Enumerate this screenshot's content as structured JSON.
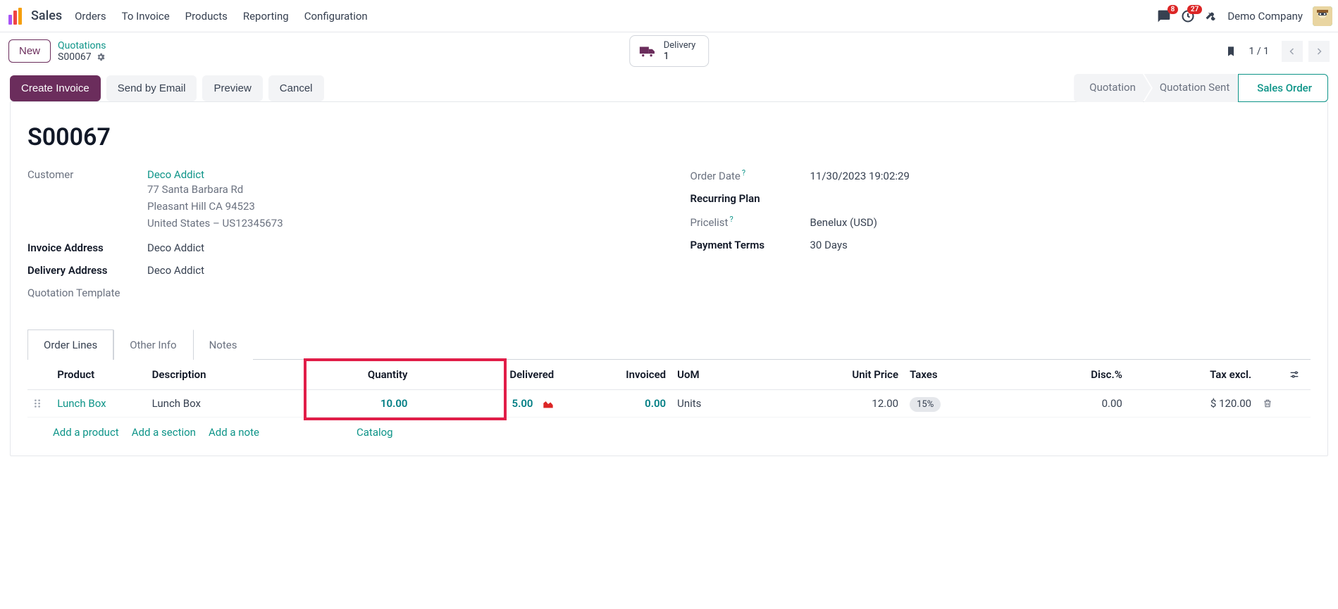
{
  "nav": {
    "app": "Sales",
    "links": [
      "Orders",
      "To Invoice",
      "Products",
      "Reporting",
      "Configuration"
    ],
    "messages_badge": "8",
    "activities_badge": "27",
    "company": "Demo Company"
  },
  "breadcrumb": {
    "new_label": "New",
    "parent": "Quotations",
    "current": "S00067"
  },
  "smart_button": {
    "label": "Delivery",
    "count": "1"
  },
  "pager": {
    "text": "1 / 1"
  },
  "actions": {
    "create_invoice": "Create Invoice",
    "send_email": "Send by Email",
    "preview": "Preview",
    "cancel": "Cancel"
  },
  "status": {
    "quotation": "Quotation",
    "quotation_sent": "Quotation Sent",
    "sales_order": "Sales Order"
  },
  "order": {
    "name": "S00067",
    "fields": {
      "customer_label": "Customer",
      "customer_link": "Deco Addict",
      "addr1": "77 Santa Barbara Rd",
      "addr2": "Pleasant Hill CA 94523",
      "addr3": "United States – US12345673",
      "invoice_address_label": "Invoice Address",
      "invoice_address": "Deco Addict",
      "delivery_address_label": "Delivery Address",
      "delivery_address": "Deco Addict",
      "quotation_template_label": "Quotation Template",
      "order_date_label": "Order Date",
      "order_date": "11/30/2023 19:02:29",
      "recurring_plan_label": "Recurring Plan",
      "pricelist_label": "Pricelist",
      "pricelist": "Benelux (USD)",
      "payment_terms_label": "Payment Terms",
      "payment_terms": "30 Days"
    }
  },
  "tabs": {
    "order_lines": "Order Lines",
    "other_info": "Other Info",
    "notes": "Notes"
  },
  "columns": {
    "product": "Product",
    "description": "Description",
    "quantity": "Quantity",
    "delivered": "Delivered",
    "invoiced": "Invoiced",
    "uom": "UoM",
    "unit_price": "Unit Price",
    "taxes": "Taxes",
    "disc": "Disc.%",
    "tax_excl": "Tax excl."
  },
  "line": {
    "product": "Lunch Box",
    "description": "Lunch Box",
    "quantity": "10.00",
    "delivered": "5.00",
    "invoiced": "0.00",
    "uom": "Units",
    "unit_price": "12.00",
    "taxes": "15%",
    "disc": "0.00",
    "tax_excl": "$ 120.00"
  },
  "add_links": {
    "product": "Add a product",
    "section": "Add a section",
    "note": "Add a note",
    "catalog": "Catalog"
  }
}
